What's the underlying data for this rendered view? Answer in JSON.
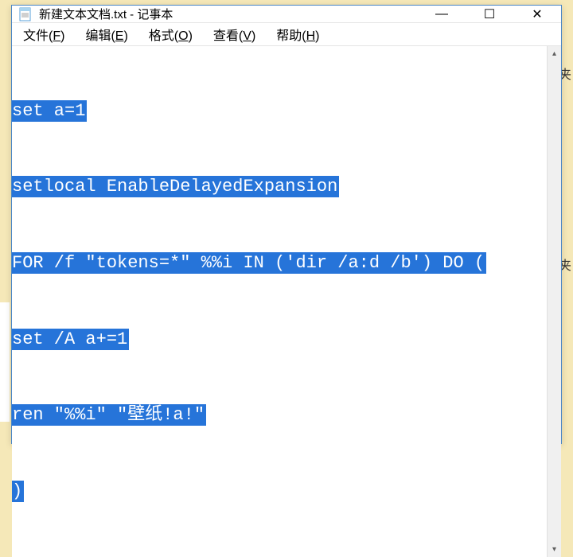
{
  "window": {
    "title": "新建文本文档.txt - 记事本",
    "icon": "notepad-icon"
  },
  "winControls": {
    "minimize": "—",
    "maximize": "☐",
    "close": "✕"
  },
  "menu": {
    "file": "文件(F)",
    "edit": "编辑(E)",
    "format": "格式(O)",
    "view": "查看(V)",
    "help": "帮助(H)"
  },
  "content": {
    "lines": [
      "set a=1",
      "setlocal EnableDelayedExpansion",
      "FOR /f \"tokens=*\" %%i IN ('dir /a:d /b') DO (",
      "set /A a+=1",
      "ren \"%%i\" \"壁纸!a!\"",
      ")"
    ]
  },
  "scrollbar": {
    "upArrow": "▴",
    "downArrow": "▾"
  },
  "bgHints": {
    "char1": "夹",
    "char2": "夹"
  }
}
